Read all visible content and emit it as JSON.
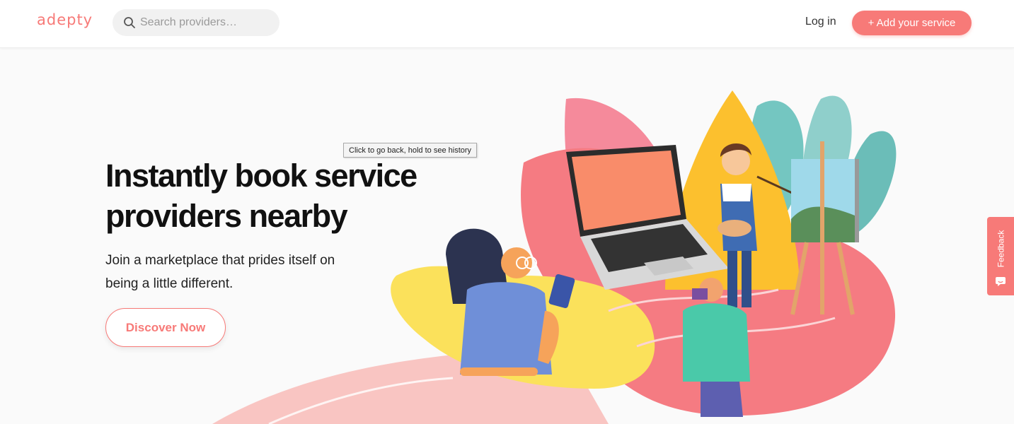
{
  "header": {
    "logo": "adepty",
    "search_placeholder": "Search providers…",
    "login_label": "Log in",
    "add_service_label": "+ Add your service"
  },
  "hero": {
    "title": "Instantly book service providers nearby",
    "subtitle": "Join a marketplace that prides itself on being a little different.",
    "cta_label": "Discover Now"
  },
  "tooltip": "Click to go back, hold to see history",
  "feedback_label": "Feedback",
  "icons": {
    "search": "search-icon",
    "feedback": "chat-icon"
  },
  "colors": {
    "brand": "#f77a78",
    "text_dark": "#111111",
    "search_bg": "#f1f1f1",
    "page_bg": "#fafafa"
  }
}
